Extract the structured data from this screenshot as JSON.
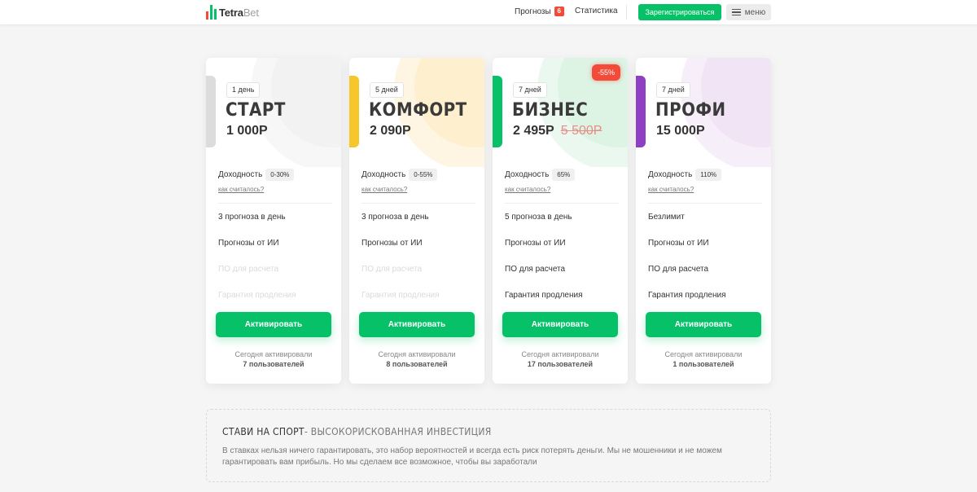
{
  "header": {
    "logo_main": "Tetra",
    "logo_sub": "Bet",
    "nav_forecasts": "Прогнозы",
    "forecasts_badge": "6",
    "nav_statistics": "Статистика",
    "register_label": "Зарегистрироваться",
    "menu_label": "меню"
  },
  "colors": {
    "brand_green": "#06c167",
    "badge_red": "#f24b3a"
  },
  "plans": [
    {
      "days": "1 день",
      "name": "СТАРТ",
      "price": "1 000Р",
      "accent": "#dcdcdc",
      "yield_label": "Доходность",
      "yield_value": "0-30%",
      "how_label": "как считалось?",
      "features": [
        "3 прогноза в день",
        "Прогнозы от ИИ",
        "ПО для расчета",
        "Гарантия продления"
      ],
      "button": "Активировать",
      "today_label": "Сегодня активировали",
      "today_count": "7 пользователей"
    },
    {
      "days": "5 дней",
      "name": "КОМФОРТ",
      "price": "2 090Р",
      "accent": "#f5c72b",
      "yield_label": "Доходность",
      "yield_value": "0-55%",
      "how_label": "как считалось?",
      "features": [
        "3 прогноза в день",
        "Прогнозы от ИИ",
        "ПО для расчета",
        "Гарантия продления"
      ],
      "button": "Активировать",
      "today_label": "Сегодня активировали",
      "today_count": "8 пользователей"
    },
    {
      "days": "7 дней",
      "name": "БИЗНЕС",
      "price": "2 495Р",
      "old_price": "5 500Р",
      "discount": "-55%",
      "accent": "#06c167",
      "yield_label": "Доходность",
      "yield_value": "65%",
      "how_label": "как считалось?",
      "features": [
        "5 прогноза в день",
        "Прогнозы от ИИ",
        "ПО для расчета",
        "Гарантия продления"
      ],
      "button": "Активировать",
      "today_label": "Сегодня активировали",
      "today_count": "17 пользователей"
    },
    {
      "days": "7 дней",
      "name": "ПРОФИ",
      "price": "15 000Р",
      "accent": "#8e3fc4",
      "yield_label": "Доходность",
      "yield_value": "110%",
      "how_label": "как считалось?",
      "features": [
        "Безлимит",
        "Прогнозы от ИИ",
        "ПО для расчета",
        "Гарантия продления"
      ],
      "button": "Активировать",
      "today_label": "Сегодня активировали",
      "today_count": "1 пользователей"
    }
  ],
  "notice": {
    "title_main": "СТАВИ НА СПОРТ",
    "title_sub": "- ВЫСОКОРИСКОВАННАЯ ИНВЕСТИЦИЯ",
    "text": "В ставках нельзя ничего гарантировать, это набор вероятностей и всегда есть риск потерять деньги. Мы не мошенники и не можем гарантировать вам прибыль. Но мы сделаем все возможное, чтобы вы заработали"
  }
}
